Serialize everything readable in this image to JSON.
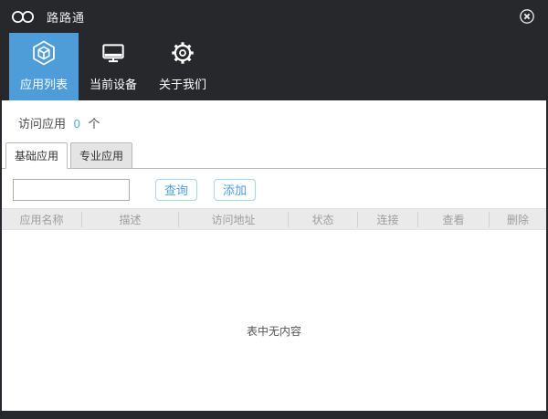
{
  "window": {
    "title": "路路通"
  },
  "titlebar": {
    "logo_icon": "infinity-rings",
    "close_icon": "circled-x"
  },
  "toolbar": {
    "items": [
      {
        "label": "应用列表",
        "icon": "cube-icon",
        "active": true
      },
      {
        "label": "当前设备",
        "icon": "monitor-icon",
        "active": false
      },
      {
        "label": "关于我们",
        "icon": "gear-icon",
        "active": false
      }
    ]
  },
  "summary": {
    "label": "访问应用",
    "count": "0",
    "unit": "个"
  },
  "tabs": [
    {
      "label": "基础应用",
      "active": true
    },
    {
      "label": "专业应用",
      "active": false
    }
  ],
  "form": {
    "search_value": "",
    "query_button": "查询",
    "add_button": "添加"
  },
  "table": {
    "columns": [
      "应用名称",
      "描述",
      "访问地址",
      "状态",
      "连接",
      "查看",
      "删除"
    ],
    "rows": [],
    "empty_message": "表中无内容"
  },
  "colors": {
    "chrome_dark": "#26282B",
    "accent_blue": "#4E9CD8",
    "count_blue": "#4FA3E8",
    "button_text_blue": "#4D9EE0",
    "button_border_blue": "#A9D2F4",
    "header_bg": "#EAEAEA",
    "header_text": "#9E9E9E"
  }
}
